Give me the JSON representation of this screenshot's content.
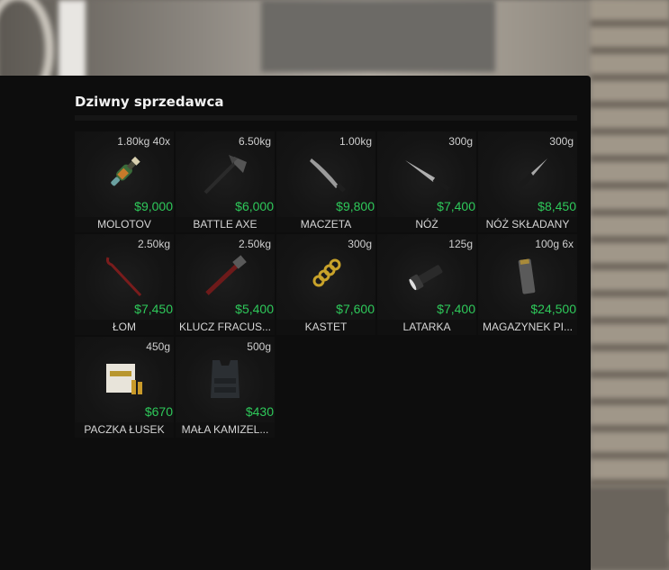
{
  "title": "Dziwny sprzedawca",
  "items": [
    {
      "weight": "1.80kg 40x",
      "price": "$9,000",
      "name": "MOLOTOV",
      "icon": "molotov-icon"
    },
    {
      "weight": "6.50kg",
      "price": "$6,000",
      "name": "BATTLE AXE",
      "icon": "axe-icon"
    },
    {
      "weight": "1.00kg",
      "price": "$9,800",
      "name": "MACZETA",
      "icon": "machete-icon"
    },
    {
      "weight": "300g",
      "price": "$7,400",
      "name": "NÓŻ",
      "icon": "knife-icon"
    },
    {
      "weight": "300g",
      "price": "$8,450",
      "name": "NÓŻ SKŁADANY",
      "icon": "folding-knife-icon"
    },
    {
      "weight": "2.50kg",
      "price": "$7,450",
      "name": "ŁOM",
      "icon": "crowbar-icon"
    },
    {
      "weight": "2.50kg",
      "price": "$5,400",
      "name": "KLUCZ FRACUS...",
      "icon": "wrench-icon"
    },
    {
      "weight": "300g",
      "price": "$7,600",
      "name": "KASTET",
      "icon": "brass-knuckles-icon"
    },
    {
      "weight": "125g",
      "price": "$7,400",
      "name": "LATARKA",
      "icon": "flashlight-icon"
    },
    {
      "weight": "100g 6x",
      "price": "$24,500",
      "name": "MAGAZYNEK PI...",
      "icon": "magazine-icon"
    },
    {
      "weight": "450g",
      "price": "$670",
      "name": "PACZKA ŁUSEK",
      "icon": "ammo-box-icon"
    },
    {
      "weight": "500g",
      "price": "$430",
      "name": "MAŁA KAMIZEL...",
      "icon": "vest-icon"
    }
  ]
}
